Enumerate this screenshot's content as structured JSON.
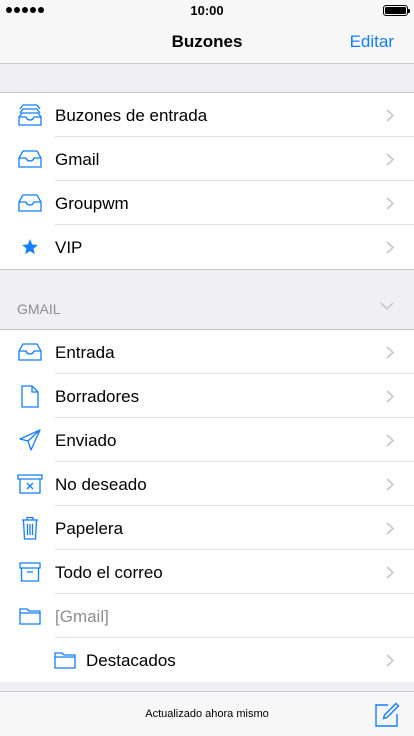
{
  "status_bar": {
    "time": "10:00"
  },
  "nav": {
    "title": "Buzones",
    "edit_label": "Editar"
  },
  "mailboxes": [
    {
      "label": "Buzones de entrada",
      "icon": "inbox-tray-icon"
    },
    {
      "label": "Gmail",
      "icon": "inbox-icon"
    },
    {
      "label": "Groupwm",
      "icon": "inbox-icon"
    },
    {
      "label": "VIP",
      "icon": "star-icon"
    }
  ],
  "account_section": {
    "header": "GMAIL",
    "items": [
      {
        "label": "Entrada",
        "icon": "inbox-icon"
      },
      {
        "label": "Borradores",
        "icon": "document-icon"
      },
      {
        "label": "Enviado",
        "icon": "paper-plane-icon"
      },
      {
        "label": "No deseado",
        "icon": "junk-icon"
      },
      {
        "label": "Papelera",
        "icon": "trash-icon"
      },
      {
        "label": "Todo el correo",
        "icon": "archive-icon"
      },
      {
        "label": "[Gmail]",
        "icon": "folder-icon"
      },
      {
        "label": "Destacados",
        "icon": "folder-icon"
      }
    ]
  },
  "toolbar": {
    "status": "Actualizado ahora mismo",
    "compose_icon": "compose-icon"
  },
  "colors": {
    "accent": "#147efb",
    "background": "#efeff4",
    "separator": "#c8c7cc"
  }
}
